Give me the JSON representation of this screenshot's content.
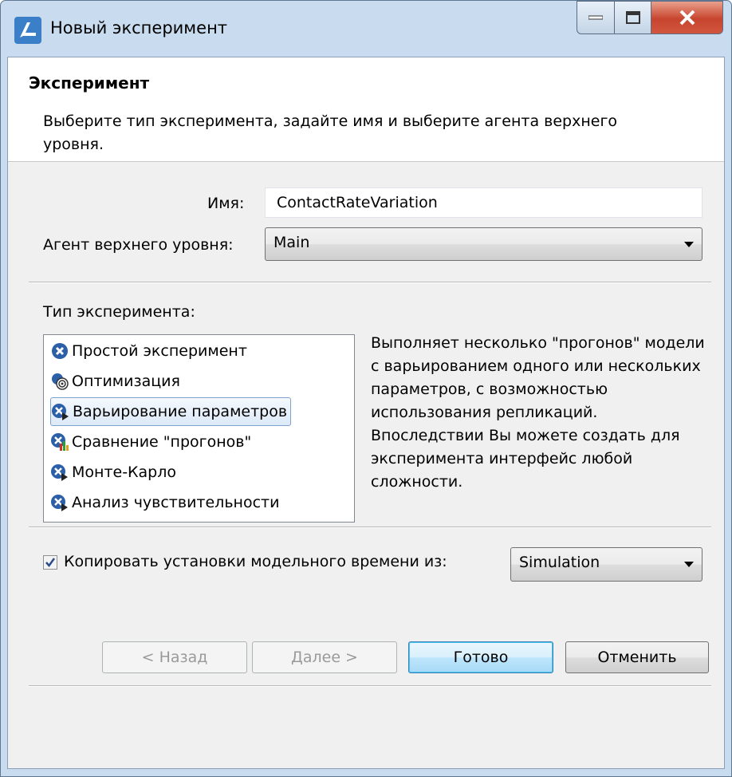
{
  "window": {
    "title": "Новый эксперимент"
  },
  "banner": {
    "title": "Эксперимент",
    "description": "Выберите тип эксперимента, задайте имя и выберите агента верхнего уровня."
  },
  "form": {
    "name_label": "Имя:",
    "name_value": "ContactRateVariation",
    "agent_label": "Агент верхнего уровня:",
    "agent_value": "Main"
  },
  "experiment_type": {
    "label": "Тип эксперимента:",
    "items": [
      {
        "label": "Простой эксперимент",
        "icon": "simple-experiment-icon"
      },
      {
        "label": "Оптимизация",
        "icon": "optimization-icon"
      },
      {
        "label": "Варьирование параметров",
        "icon": "parameter-variation-icon",
        "selected": true
      },
      {
        "label": "Сравнение \"прогонов\"",
        "icon": "compare-runs-icon"
      },
      {
        "label": "Монте-Карло",
        "icon": "monte-carlo-icon"
      },
      {
        "label": "Анализ чувствительности",
        "icon": "sensitivity-analysis-icon"
      }
    ],
    "description": "Выполняет несколько \"прогонов\" модели с варьированием одного или нескольких параметров, с возможностью использования репликаций.\nВпоследствии Вы можете создать для эксперимента интерфейс любой сложности."
  },
  "copy_settings": {
    "label": "Копировать установки модельного времени из:",
    "checked": true,
    "source_value": "Simulation"
  },
  "buttons": {
    "back": "< Назад",
    "next": "Далее >",
    "finish": "Готово",
    "cancel": "Отменить"
  },
  "colors": {
    "accent": "#2f5f9c",
    "selection_border": "#7da2ce"
  }
}
